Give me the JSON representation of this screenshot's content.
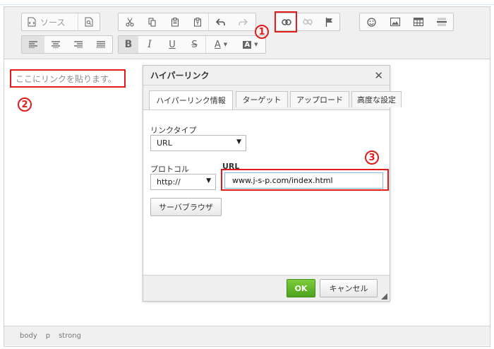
{
  "toolbar": {
    "source_label": "ソース",
    "icons": {
      "source": "source-code-icon",
      "preview": "preview-icon",
      "cut": "scissors-icon",
      "copy": "copy-icon",
      "paste": "paste-icon",
      "paste_text": "paste-text-icon",
      "undo": "undo-icon",
      "redo": "redo-icon",
      "link": "link-icon",
      "unlink": "unlink-icon",
      "anchor": "flag-icon",
      "smiley": "smiley-icon",
      "image": "image-icon",
      "table": "table-icon",
      "hr": "horizontal-rule-icon"
    },
    "align_left": "≡",
    "bold_label": "B",
    "italic_label": "I",
    "underline_label": "U",
    "strike_label": "S",
    "text_color_label": "A",
    "bg_color_label": "A"
  },
  "annotations": {
    "one": "1",
    "two": "2",
    "three": "3",
    "color": "#e31b1b"
  },
  "content": {
    "text": "ここにリンクを貼ります。"
  },
  "statusbar": {
    "path": [
      "body",
      "p",
      "strong"
    ]
  },
  "dialog": {
    "title": "ハイパーリンク",
    "close": "✕",
    "tabs": [
      "ハイパーリンク情報",
      "ターゲット",
      "アップロード",
      "高度な設定"
    ],
    "link_type_label": "リンクタイプ",
    "link_type_value": "URL",
    "protocol_label": "プロトコル",
    "protocol_value": "http://",
    "url_label": "URL",
    "url_value": "www.j-s-p.com/index.html",
    "browse_button": "サーバブラウザ",
    "ok_button": "OK",
    "cancel_button": "キャンセル"
  },
  "colors": {
    "ok_green": "#5cb32a",
    "accent_red": "#e31b1b"
  }
}
